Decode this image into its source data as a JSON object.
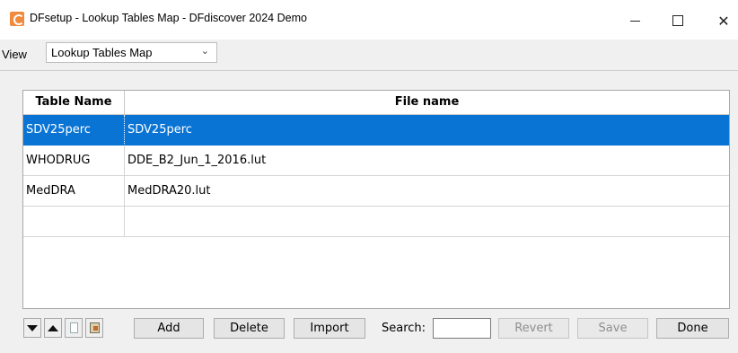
{
  "window": {
    "title": "DFsetup - Lookup Tables Map - DFdiscover 2024 Demo",
    "controls": {
      "minimize": "minimize",
      "maximize": "maximize",
      "close": "✕"
    }
  },
  "view": {
    "label": "View",
    "selected": "Lookup Tables Map"
  },
  "table": {
    "columns": [
      "Table Name",
      "File name"
    ],
    "rows": [
      {
        "table_name": "SDV25perc",
        "file_name": "SDV25perc",
        "selected": true
      },
      {
        "table_name": "WHODRUG",
        "file_name": "DDE_B2_Jun_1_2016.lut",
        "selected": false
      },
      {
        "table_name": "MedDRA",
        "file_name": "MedDRA20.lut",
        "selected": false
      },
      {
        "table_name": "",
        "file_name": "",
        "selected": false
      }
    ]
  },
  "toolbar": {
    "icons": [
      "move-down-icon",
      "move-up-icon",
      "new-document-icon",
      "import-document-icon"
    ],
    "add_label": "Add",
    "delete_label": "Delete",
    "import_label": "Import",
    "search_label": "Search:",
    "search_value": "",
    "revert_label": "Revert",
    "save_label": "Save",
    "done_label": "Done"
  },
  "colors": {
    "selection": "#0a74d4",
    "app_icon": "#f08a3c"
  }
}
